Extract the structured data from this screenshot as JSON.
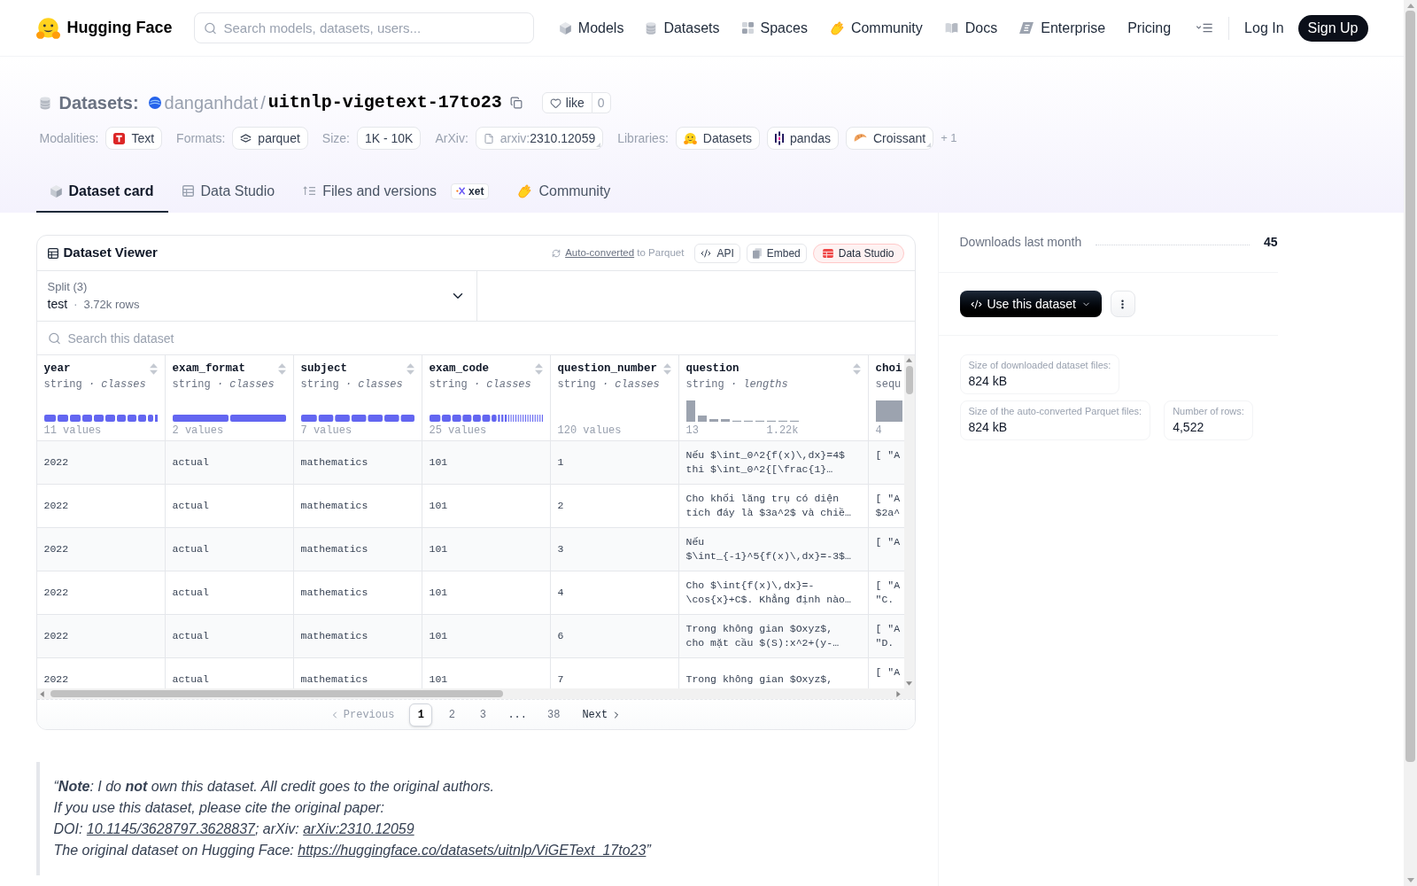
{
  "header": {
    "brand": "Hugging Face",
    "search": {
      "placeholder": "Search models, datasets, users..."
    },
    "nav": [
      {
        "label": "Models",
        "kind": "models"
      },
      {
        "label": "Datasets",
        "kind": "datasets"
      },
      {
        "label": "Spaces",
        "kind": "spaces"
      },
      {
        "label": "Community",
        "kind": "community"
      },
      {
        "label": "Docs",
        "kind": "docs"
      },
      {
        "label": "Enterprise",
        "kind": "enterprise"
      },
      {
        "label": "Pricing",
        "kind": "plain"
      }
    ],
    "login": "Log In",
    "signup": "Sign Up"
  },
  "repo": {
    "type_label": "Datasets:",
    "owner": "danganhdat",
    "separator": "/",
    "name": "uitnlp-vigetext-17to23",
    "like": {
      "label": "like",
      "count": "0"
    }
  },
  "metadata": [
    {
      "label": "Modalities:",
      "tags": [
        {
          "text": "Text",
          "kind": "text"
        }
      ]
    },
    {
      "label": "Formats:",
      "tags": [
        {
          "text": "parquet",
          "kind": "parquet"
        }
      ]
    },
    {
      "label": "Size:",
      "tags": [
        {
          "text": "1K - 10K",
          "kind": "plain"
        }
      ]
    },
    {
      "label": "ArXiv:",
      "tags": [
        {
          "prefix": "arxiv:",
          "text": "2310.12059",
          "kind": "arxiv"
        }
      ]
    },
    {
      "label": "Libraries:",
      "tags": [
        {
          "text": "Datasets",
          "kind": "datasets"
        },
        {
          "text": "pandas",
          "kind": "pandas"
        },
        {
          "text": "Croissant",
          "kind": "croissant"
        }
      ],
      "more": "+ 1"
    }
  ],
  "tabs": [
    {
      "label": "Dataset card",
      "kind": "card",
      "selected": true
    },
    {
      "label": "Data Studio",
      "kind": "studio",
      "selected": false
    },
    {
      "label": "Files and versions",
      "kind": "files",
      "badge": "xet",
      "selected": false
    },
    {
      "label": "Community",
      "kind": "community",
      "selected": false
    }
  ],
  "viewer": {
    "title": "Dataset Viewer",
    "conversion": {
      "link": "Auto-converted",
      "text": "to Parquet"
    },
    "actions": [
      {
        "label": "API",
        "kind": "api"
      },
      {
        "label": "Embed",
        "kind": "embed"
      },
      {
        "label": "Data Studio",
        "kind": "studio"
      }
    ],
    "split": {
      "label": "Split (3)",
      "value": "test",
      "separator": "·",
      "rows": "3.72k rows"
    },
    "search": {
      "placeholder": "Search this dataset"
    },
    "columns": [
      {
        "name": "year",
        "type": "string *· classes*",
        "kind": "class_bar",
        "summary": "11 values"
      },
      {
        "name": "exam_format",
        "type": "string *· classes*",
        "kind": "class_bar",
        "summary": "2 values"
      },
      {
        "name": "subject",
        "type": "string *· classes*",
        "kind": "class_bar",
        "summary": "7 values"
      },
      {
        "name": "exam_code",
        "type": "string *· classes*",
        "kind": "class_bar",
        "summary": "25 values"
      },
      {
        "name": "question_number",
        "type": "string *· classes*",
        "kind": "class_count",
        "summary": "120 values"
      },
      {
        "name": "question",
        "type": "string *· lengths*",
        "kind": "text_lengths",
        "min": "13",
        "max": "1.22k"
      },
      {
        "name": "choi",
        "type": "sequ",
        "kind": "sequence",
        "summary": "4"
      }
    ],
    "rows": [
      [
        "2022",
        "actual",
        "mathematics",
        "101",
        "1",
        "Nếu $\\int_0^2{f(x)\\,dx}=4$\nthi $\\int_0^2{[\\frac{1}…",
        "[ \"A"
      ],
      [
        "2022",
        "actual",
        "mathematics",
        "101",
        "2",
        "Cho khối lăng trụ có diện\ntích đáy là $3a^2$ và chiề…",
        "[ \"A\n$2a^"
      ],
      [
        "2022",
        "actual",
        "mathematics",
        "101",
        "3",
        "Nếu\n$\\int_{-1}^5{f(x)\\,dx}=-3$…",
        "[ \"A"
      ],
      [
        "2022",
        "actual",
        "mathematics",
        "101",
        "4",
        "Cho $\\int{f(x)\\,dx}=-\n\\cos{x}+C$. Khẳng định nào…",
        "[ \"A\n\"C."
      ],
      [
        "2022",
        "actual",
        "mathematics",
        "101",
        "6",
        "Trong không gian $Oxyz$,\ncho mặt cầu $(S):x^2+(y-…",
        "[ \"A\n\"D."
      ],
      [
        "2022",
        "actual",
        "mathematics",
        "101",
        "7",
        "Trong không gian $Oxyz$,",
        "[ \"A"
      ]
    ],
    "pagination": {
      "previous": {
        "label": "Previous",
        "disabled": true
      },
      "pages": [
        {
          "label": "1",
          "kind": "page",
          "selected": true
        },
        {
          "label": "2",
          "kind": "page",
          "selected": false
        },
        {
          "label": "3",
          "kind": "page",
          "selected": false
        },
        {
          "label": "...",
          "kind": "ellipsis"
        },
        {
          "label": "38",
          "kind": "page",
          "selected": false
        }
      ],
      "next": {
        "label": "Next",
        "disabled": false
      }
    }
  },
  "sidebar": {
    "downloads": {
      "label": "Downloads last month",
      "value": "45"
    },
    "use_button": "Use this dataset",
    "stats": [
      {
        "label": "Size of downloaded dataset files:",
        "value": "824 kB"
      },
      {
        "label": "Size of the auto-converted Parquet files:",
        "value": "824 kB"
      },
      {
        "label": "Number of rows:",
        "value": "4,522"
      }
    ]
  },
  "quote": {
    "lines": [
      {
        "parts": [
          {
            "kind": "text",
            "text": "“**Note**: I do **not** own this dataset. All credit goes to the original authors."
          }
        ]
      },
      {
        "parts": [
          {
            "kind": "text",
            "text": "If you use this dataset, please cite the original paper:"
          }
        ]
      },
      {
        "parts": [
          {
            "kind": "text",
            "text": "DOI: "
          },
          {
            "kind": "link",
            "text": "10.1145/3628797.3628837"
          },
          {
            "kind": "text",
            "text": "; arXiv: "
          },
          {
            "kind": "link",
            "text": "arXiv:2310.12059"
          }
        ]
      },
      {
        "parts": [
          {
            "kind": "text",
            "text": "The original dataset on Hugging Face: "
          },
          {
            "kind": "link",
            "text": "https://huggingface.co/datasets/uitnlp/ViGEText_17to23"
          },
          {
            "kind": "text",
            "text": "”"
          }
        ]
      }
    ]
  }
}
